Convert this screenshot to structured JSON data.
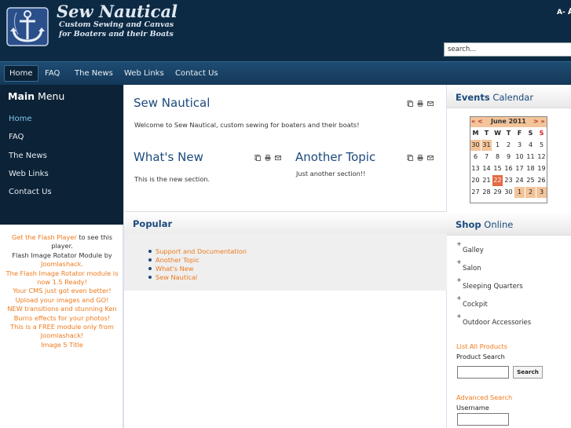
{
  "header": {
    "site_title": "Sew Nautical",
    "tagline_line1": "Custom Sewing and Canvas",
    "tagline_line2": "for Boaters and their Boats",
    "font_small": "A-",
    "font_large": "A",
    "search_placeholder": "search..."
  },
  "nav": {
    "items": [
      "Home",
      "FAQ",
      "The News",
      "Web Links",
      "Contact Us"
    ],
    "active": "Home"
  },
  "main_menu": {
    "title_bold": "Main",
    "title_rest": " Menu",
    "items": [
      "Home",
      "FAQ",
      "The News",
      "Web Links",
      "Contact Us"
    ]
  },
  "flash_module": {
    "line1_link": "Get the Flash Player",
    "line1_rest": " to see this player.",
    "line2": "Flash Image Rotator Module by",
    "line3": "Joomlashack.",
    "line4": "The Flash Image Rotator module is now 1.5 Ready!",
    "line5": "Your CMS just got even better!",
    "line6": "Upload your images and GO!",
    "line7": "NEW transitions and stunning Ken Burns effects for your photos!",
    "line8": "This is a FREE module only from Joomlashack!",
    "line9": "Image 5 Title"
  },
  "content": {
    "title": "Sew Nautical",
    "intro": "Welcome to Sew Nautical, custom sewing for boaters and their boats!",
    "section1_title": "What's New",
    "section1_text": "This is the new section.",
    "section2_title": "Another Topic",
    "section2_text": "Just another section!!"
  },
  "popular": {
    "title": "Popular",
    "items": [
      "Support and Documentation",
      "Another Topic",
      "What's New",
      "Sew Nautical"
    ]
  },
  "events_calendar": {
    "title_bold": "Events",
    "title_rest": " Calendar",
    "prev": "« <",
    "month": "June 2011",
    "next": "> »",
    "dow": [
      "M",
      "T",
      "W",
      "T",
      "F",
      "S",
      "S"
    ],
    "weeks": [
      [
        "30",
        "31",
        "1",
        "2",
        "3",
        "4",
        "5"
      ],
      [
        "6",
        "7",
        "8",
        "9",
        "10",
        "11",
        "12"
      ],
      [
        "13",
        "14",
        "15",
        "16",
        "17",
        "18",
        "19"
      ],
      [
        "20",
        "21",
        "22",
        "23",
        "24",
        "25",
        "26"
      ],
      [
        "27",
        "28",
        "29",
        "30",
        "1",
        "2",
        "3"
      ]
    ],
    "today": "22"
  },
  "shop": {
    "title_bold": "Shop",
    "title_rest": " Online",
    "items": [
      "Galley",
      "Salon",
      "Sleeping Quarters",
      "Cockpit",
      "Outdoor Accessories"
    ],
    "list_all": "List All Products",
    "product_search_label": "Product Search",
    "search_button": "Search",
    "advanced_search": "Advanced Search",
    "username_label": "Username"
  },
  "colors": {
    "header_bg": "#0d2a45",
    "nav_bg": "#1e4c73",
    "heading_blue": "#1b4a7c",
    "link_orange": "#ee7a1c",
    "calendar_highlight": "#f3c49a",
    "calendar_today": "#e46a45"
  }
}
